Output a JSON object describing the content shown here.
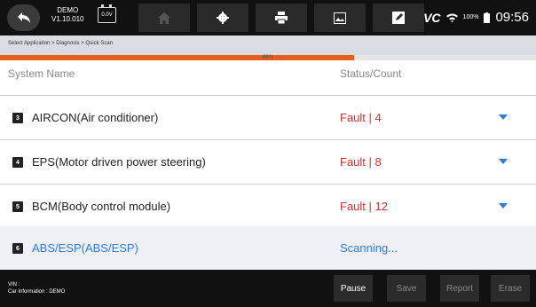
{
  "topbar": {
    "version_line1": "DEMO",
    "version_line2": "V1.10.010",
    "battery_voltage": "0.0V",
    "vc_label": "VC",
    "battery_percent": "100%",
    "time": "09:56"
  },
  "breadcrumb": "Select Application > Diagnosis >   Quick Scan",
  "progress": {
    "value": 0.66,
    "label": "66%"
  },
  "table": {
    "col_system": "System Name",
    "col_status": "Status/Count",
    "rows": [
      {
        "num": "3",
        "name": "AIRCON(Air conditioner)",
        "status": "Fault | 4",
        "expandable": true
      },
      {
        "num": "4",
        "name": "EPS(Motor driven power steering)",
        "status": "Fault | 8",
        "expandable": true
      },
      {
        "num": "5",
        "name": "BCM(Body control module)",
        "status": "Fault | 12",
        "expandable": true
      },
      {
        "num": "6",
        "name": "ABS/ESP(ABS/ESP)",
        "status": "Scanning...",
        "expandable": false
      }
    ]
  },
  "footer": {
    "vin_label": "VIN :",
    "car_info": "Car Information : DEMO",
    "buttons": {
      "pause": "Pause",
      "save": "Save",
      "report": "Report",
      "erase": "Erase"
    }
  },
  "colors": {
    "fault": "#d32f2f",
    "accent": "#2d7be4",
    "progress": "#e85d1c"
  }
}
